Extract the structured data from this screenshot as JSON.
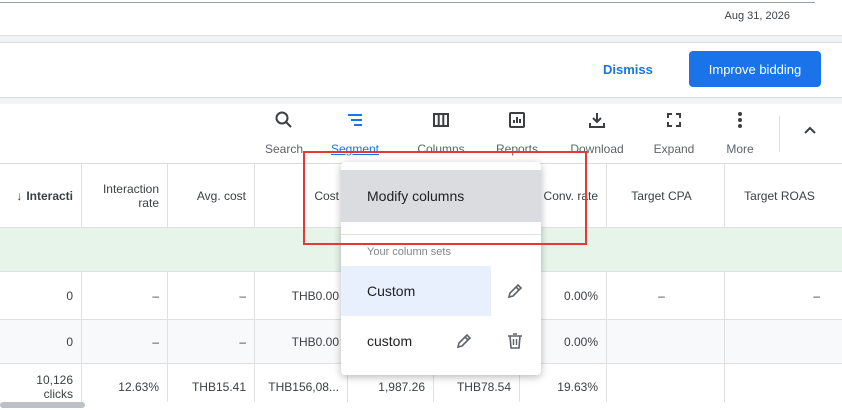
{
  "top": {
    "date": "Aug 31, 2026"
  },
  "banner": {
    "dismiss_label": "Dismiss",
    "improve_label": "Improve bidding"
  },
  "toolbar": {
    "items": [
      {
        "label": "Search",
        "icon": "search-icon"
      },
      {
        "label": "Segment",
        "icon": "segment-icon"
      },
      {
        "label": "Columns",
        "icon": "columns-icon"
      },
      {
        "label": "Reports",
        "icon": "reports-icon"
      },
      {
        "label": "Download",
        "icon": "download-icon"
      },
      {
        "label": "Expand",
        "icon": "expand-icon"
      },
      {
        "label": "More",
        "icon": "more-vert-icon"
      }
    ],
    "active": "Segment"
  },
  "table": {
    "headers": [
      "Interacti",
      "Interaction rate",
      "Avg. cost",
      "Cost",
      "",
      "",
      "Conv. rate",
      "Target CPA",
      "Target ROAS"
    ],
    "header_rate_line1": "Interaction",
    "header_rate_line2": "rate",
    "sort_indicator": "↓",
    "rows": [
      [
        "0",
        "–",
        "–",
        "THB0.00",
        "",
        "",
        "0.00%",
        "–",
        "–"
      ],
      [
        "0",
        "–",
        "–",
        "THB0.00",
        "",
        "",
        "0.00%",
        "",
        ""
      ],
      [
        "10,126 clicks",
        "12.63%",
        "THB15.41",
        "THB156,08...",
        "1,987.26",
        "THB78.54",
        "19.63%",
        "",
        ""
      ]
    ],
    "row3_first_line1": "10,126",
    "row3_first_line2": "clicks"
  },
  "dropdown": {
    "modify_label": "Modify columns",
    "section_label": "Your column sets",
    "items": [
      "Custom",
      "custom"
    ]
  },
  "colors": {
    "accent": "#1a73e8",
    "highlight": "#e53935",
    "green_row": "#e6f4ea",
    "selected": "#e8f0fe"
  }
}
